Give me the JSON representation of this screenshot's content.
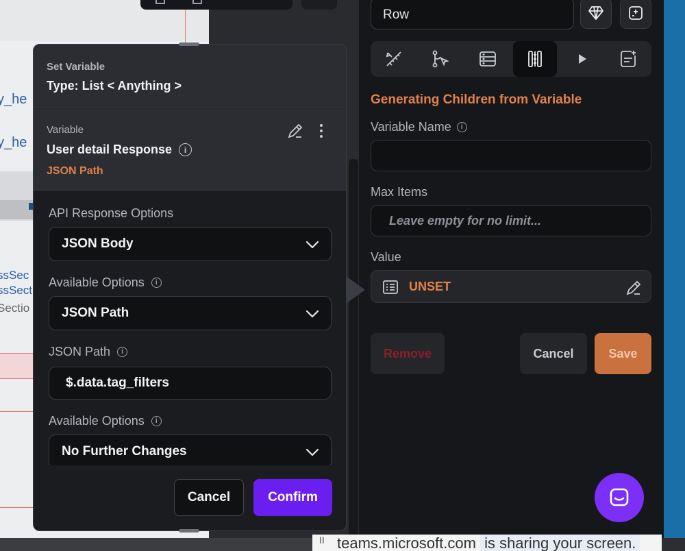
{
  "canvas": {
    "fragments": [
      "y_he",
      "y_he",
      "ssSec",
      "ssSecti",
      "Sectio"
    ]
  },
  "properties": {
    "widget_name": "Row",
    "section_title": "Generating Children from Variable",
    "variable_name_label": "Variable Name",
    "max_items_label": "Max Items",
    "max_items_placeholder": "Leave empty for no limit...",
    "value_label": "Value",
    "value_text": "UNSET",
    "remove_label": "Remove",
    "cancel_label": "Cancel",
    "save_label": "Save",
    "tabs": [
      "properties",
      "actions",
      "backend-query",
      "generate-children",
      "animations",
      "documentation"
    ],
    "active_tab": "generate-children"
  },
  "modal": {
    "kicker": "Set Variable",
    "type_label": "Type: List < Anything >",
    "variable_kicker": "Variable",
    "variable_name": "User detail Response",
    "variable_path": "JSON Path",
    "fields": [
      {
        "label": "API Response Options",
        "value": "JSON Body",
        "info": false
      },
      {
        "label": "Available Options",
        "value": "JSON Path",
        "info": true
      },
      {
        "label": "JSON Path",
        "value": "$.data.tag_filters",
        "info": true
      },
      {
        "label": "Available Options",
        "value": "No Further Changes",
        "info": true
      }
    ],
    "cancel_label": "Cancel",
    "confirm_label": "Confirm"
  },
  "share_bar": {
    "prefix": "II",
    "host": "teams.microsoft.com",
    "message": "is sharing your screen."
  },
  "colors": {
    "accent_orange": "#e2814a",
    "confirm_purple": "#6a1ef0",
    "chat_purple": "#7b2ff7",
    "remove_red": "#8b1f24"
  }
}
